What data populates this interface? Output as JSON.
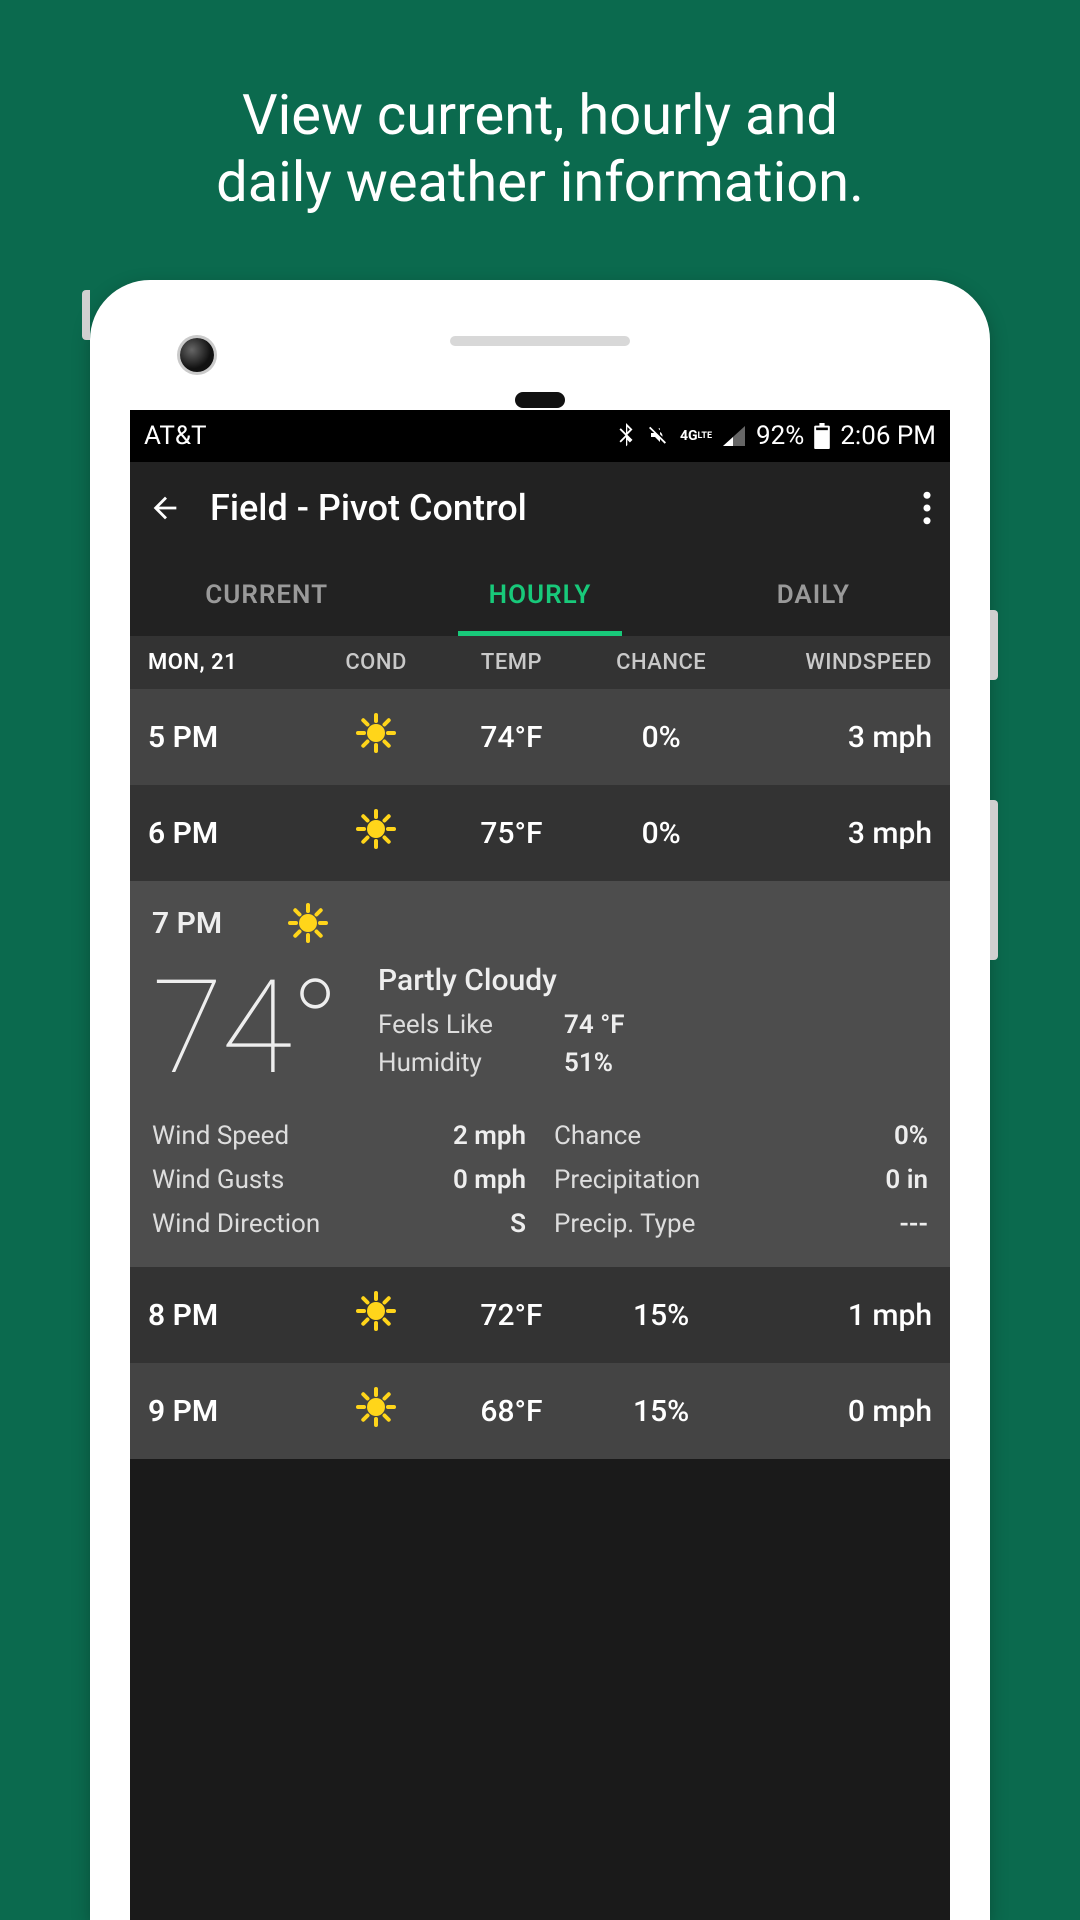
{
  "promo": {
    "line1": "View current, hourly and",
    "line2": "daily weather information."
  },
  "status": {
    "carrier": "AT&T",
    "battery_pct": "92%",
    "clock": "2:06 PM",
    "network_label": "4G LTE"
  },
  "appbar": {
    "title": "Field - Pivot Control"
  },
  "tabs": {
    "current": "CURRENT",
    "hourly": "HOURLY",
    "daily": "DAILY",
    "active": "hourly"
  },
  "columns": {
    "date": "MON, 21",
    "cond": "COND",
    "temp": "TEMP",
    "chance": "CHANCE",
    "wind": "WINDSPEED"
  },
  "hours": [
    {
      "time": "5 PM",
      "cond": "sunny",
      "temp": "74°F",
      "chance": "0%",
      "wind": "3 mph"
    },
    {
      "time": "6 PM",
      "cond": "sunny",
      "temp": "75°F",
      "chance": "0%",
      "wind": "3 mph"
    },
    {
      "time": "7 PM",
      "cond": "sunny"
    },
    {
      "time": "8 PM",
      "cond": "sunny",
      "temp": "72°F",
      "chance": "15%",
      "wind": "1 mph"
    },
    {
      "time": "9 PM",
      "cond": "sunny",
      "temp": "68°F",
      "chance": "15%",
      "wind": "0 mph"
    }
  ],
  "expanded": {
    "big_temp": "74°",
    "summary": "Partly Cloudy",
    "feels_like_label": "Feels Like",
    "feels_like_value": "74 °F",
    "humidity_label": "Humidity",
    "humidity_value": "51%",
    "wind_speed_label": "Wind Speed",
    "wind_speed_value": "2 mph",
    "wind_gusts_label": "Wind Gusts",
    "wind_gusts_value": "0 mph",
    "wind_dir_label": "Wind Direction",
    "wind_dir_value": "S",
    "chance_label": "Chance",
    "chance_value": "0%",
    "precip_label": "Precipitation",
    "precip_value": "0 in",
    "precip_type_label": "Precip. Type",
    "precip_type_value": "---"
  }
}
